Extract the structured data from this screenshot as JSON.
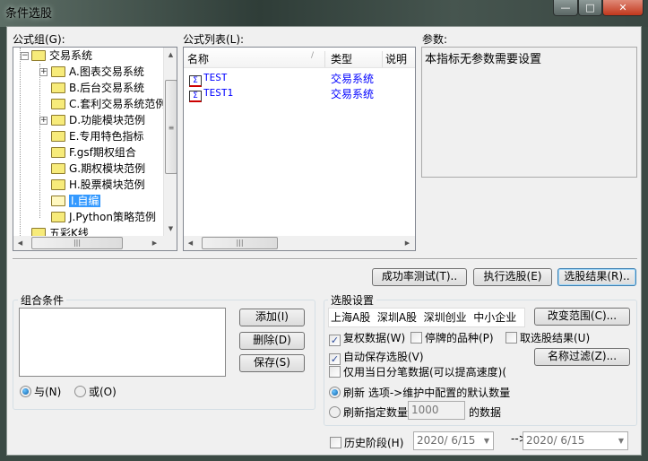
{
  "window": {
    "title": "条件选股",
    "minimize": "—",
    "maximize": "□",
    "close": "✕"
  },
  "formula_group": {
    "label": "公式组(G):",
    "items": [
      {
        "label": "交易系统",
        "expander": "−"
      },
      {
        "label": "A.图表交易系统",
        "expander": "+"
      },
      {
        "label": "B.后台交易系统"
      },
      {
        "label": "C.套利交易系统范例"
      },
      {
        "label": "D.功能模块范例",
        "expander": "+"
      },
      {
        "label": "E.专用特色指标"
      },
      {
        "label": "F.gsf期权组合"
      },
      {
        "label": "G.期权模块范例"
      },
      {
        "label": "H.股票模块范例"
      },
      {
        "label": "I.自编",
        "selected": true
      },
      {
        "label": "J.Python策略范例"
      },
      {
        "label": "五彩K线"
      }
    ]
  },
  "formula_list": {
    "label": "公式列表(L):",
    "columns": [
      "名称",
      "类型",
      "说明"
    ],
    "sort_mark": "/",
    "rows": [
      {
        "name": "TEST",
        "type": "交易系统"
      },
      {
        "name": "TEST1",
        "type": "交易系统"
      }
    ]
  },
  "params": {
    "label": "参数:",
    "text": "本指标无参数需要设置"
  },
  "actions": {
    "success_test": "成功率测试(T)..",
    "execute": "执行选股(E)",
    "results": "选股结果(R).."
  },
  "combo": {
    "title": "组合条件",
    "add": "添加(I)",
    "delete": "删除(D)",
    "save": "保存(S)",
    "and": "与(N)",
    "or": "或(O)",
    "and_selected": true
  },
  "settings": {
    "title": "选股设置",
    "markets": "上海A股  深圳A股  深圳创业  中小企业",
    "change_range": "改变范围(C)...",
    "name_filter": "名称过滤(Z)...",
    "fuquan": {
      "label": "复权数据(W)",
      "checked": true
    },
    "suspended": {
      "label": "停牌的品种(P)",
      "checked": false
    },
    "take_results": {
      "label": "取选股结果(U)",
      "checked": false
    },
    "autosave": {
      "label": "自动保存选股(V)",
      "checked": true
    },
    "tick_only": {
      "label": "仅用当日分笔数据(可以提高速度)(",
      "checked": false
    },
    "refresh_default": {
      "label": "刷新 选项->维护中配置的默认数量",
      "selected": true
    },
    "refresh_count": {
      "label": "刷新指定数量",
      "value": "1000",
      "suffix": "的数据",
      "selected": false
    }
  },
  "history": {
    "label": "历史阶段(H)",
    "checked": false,
    "from": "2020/ 6/15",
    "arrow": "-->",
    "to": "2020/ 6/15"
  }
}
